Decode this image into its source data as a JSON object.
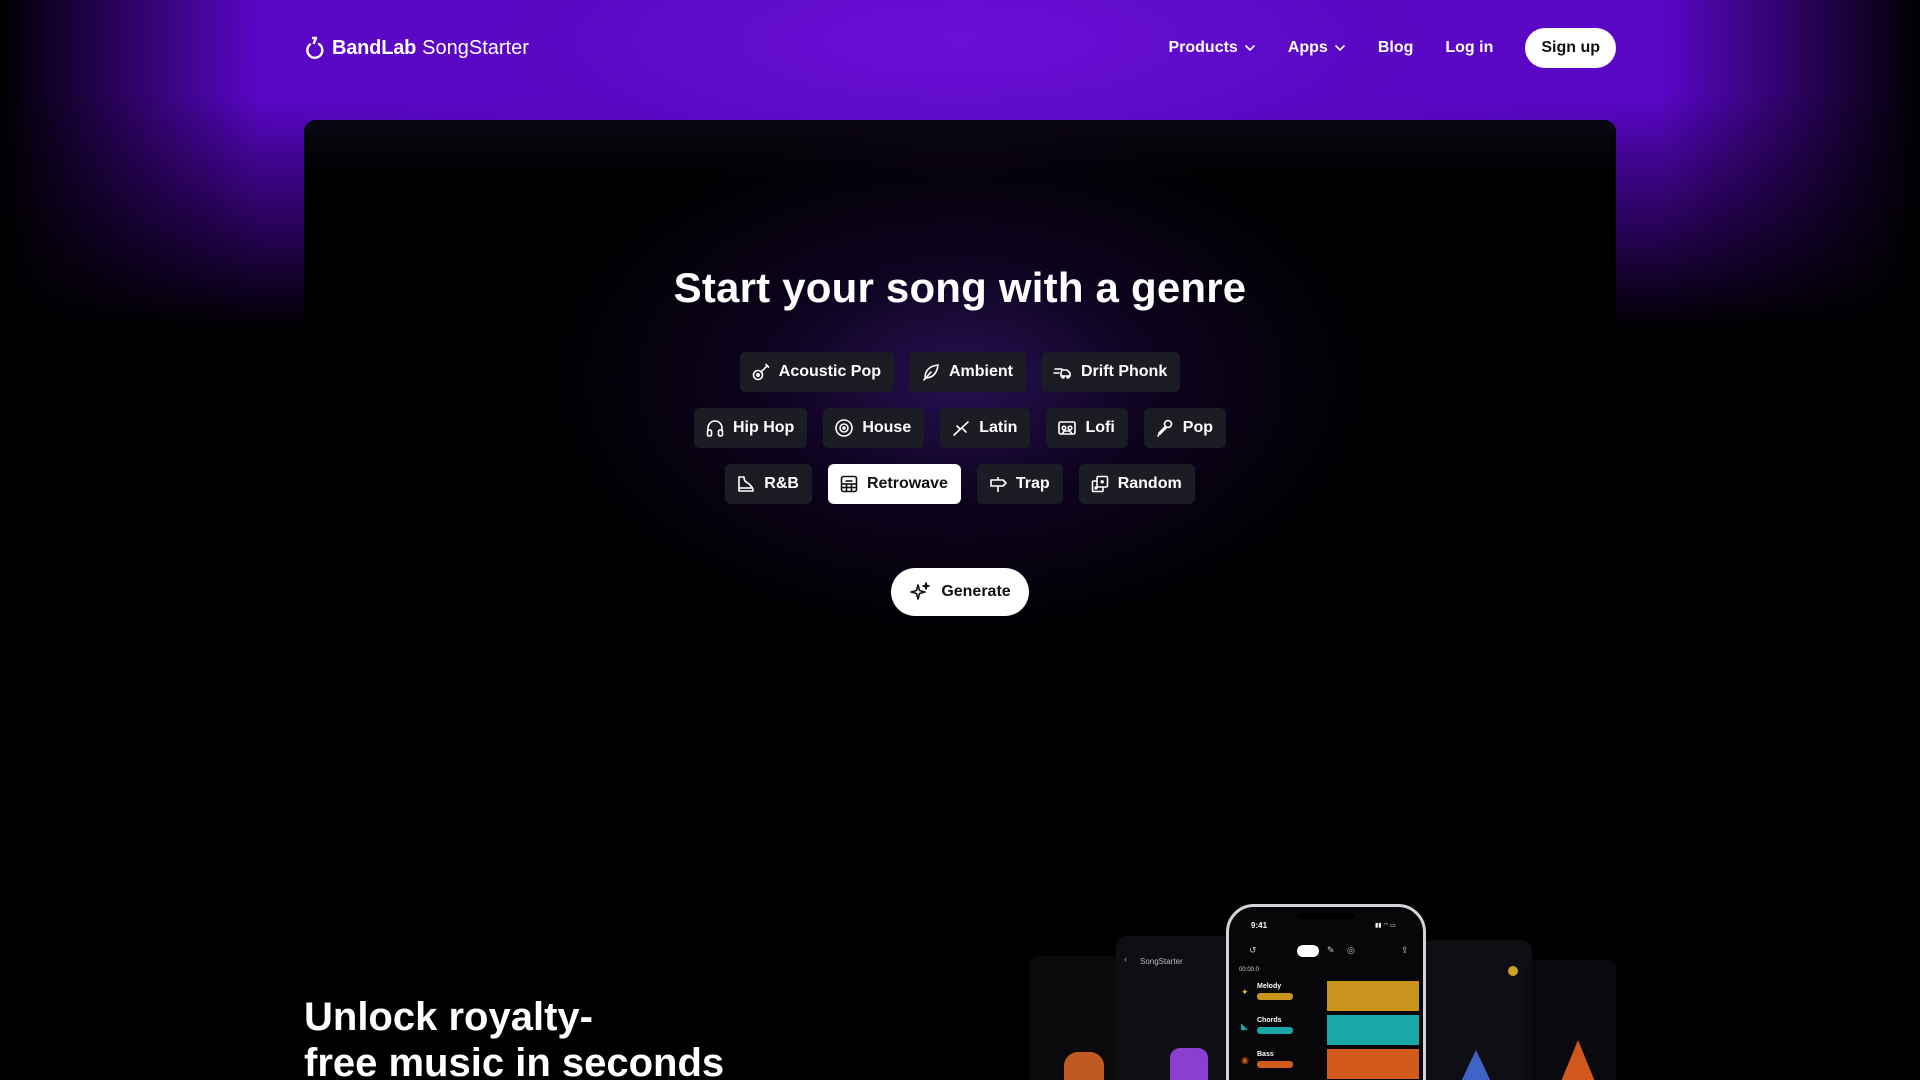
{
  "colors": {
    "header_purple": "#5a06c8",
    "chip_bg": "#1c1c24",
    "selected_chip_bg": "#ffffff",
    "track_melody": "#c9951c",
    "track_chords": "#1aa7a7",
    "track_bass": "#d25a1a"
  },
  "nav": {
    "brand": "BandLab",
    "product": "SongStarter",
    "links": [
      {
        "label": "Products",
        "icon": "chevron-down-icon"
      },
      {
        "label": "Apps",
        "icon": "chevron-down-icon"
      },
      {
        "label": "Blog"
      },
      {
        "label": "Log in"
      }
    ],
    "signup_label": "Sign up"
  },
  "hero": {
    "title": "Start your song with a genre",
    "genres": [
      {
        "label": "Acoustic Pop",
        "icon": "guitar-icon",
        "selected": false
      },
      {
        "label": "Ambient",
        "icon": "leaf-icon",
        "selected": false
      },
      {
        "label": "Drift Phonk",
        "icon": "wind-car-icon",
        "selected": false
      },
      {
        "label": "Hip Hop",
        "icon": "headphones-icon",
        "selected": false
      },
      {
        "label": "House",
        "icon": "vinyl-icon",
        "selected": false
      },
      {
        "label": "Latin",
        "icon": "maracas-icon",
        "selected": false
      },
      {
        "label": "Lofi",
        "icon": "cassette-icon",
        "selected": false
      },
      {
        "label": "Pop",
        "icon": "microphone-icon",
        "selected": false
      },
      {
        "label": "R&B",
        "icon": "piano-icon",
        "selected": false
      },
      {
        "label": "Retrowave",
        "icon": "grid-sun-icon",
        "selected": true
      },
      {
        "label": "Trap",
        "icon": "signpost-icon",
        "selected": false
      },
      {
        "label": "Random",
        "icon": "dice-icon",
        "selected": false
      }
    ],
    "generate_label": "Generate",
    "generate_icon": "sparkle-icon"
  },
  "section2": {
    "title_line1": "Unlock royalty-",
    "title_line2": "free music in seconds"
  },
  "phone": {
    "time": "9:41",
    "timer": "00:00.0",
    "tracks": [
      "Melody",
      "Chords",
      "Bass"
    ],
    "side_label": "SongStarter"
  }
}
